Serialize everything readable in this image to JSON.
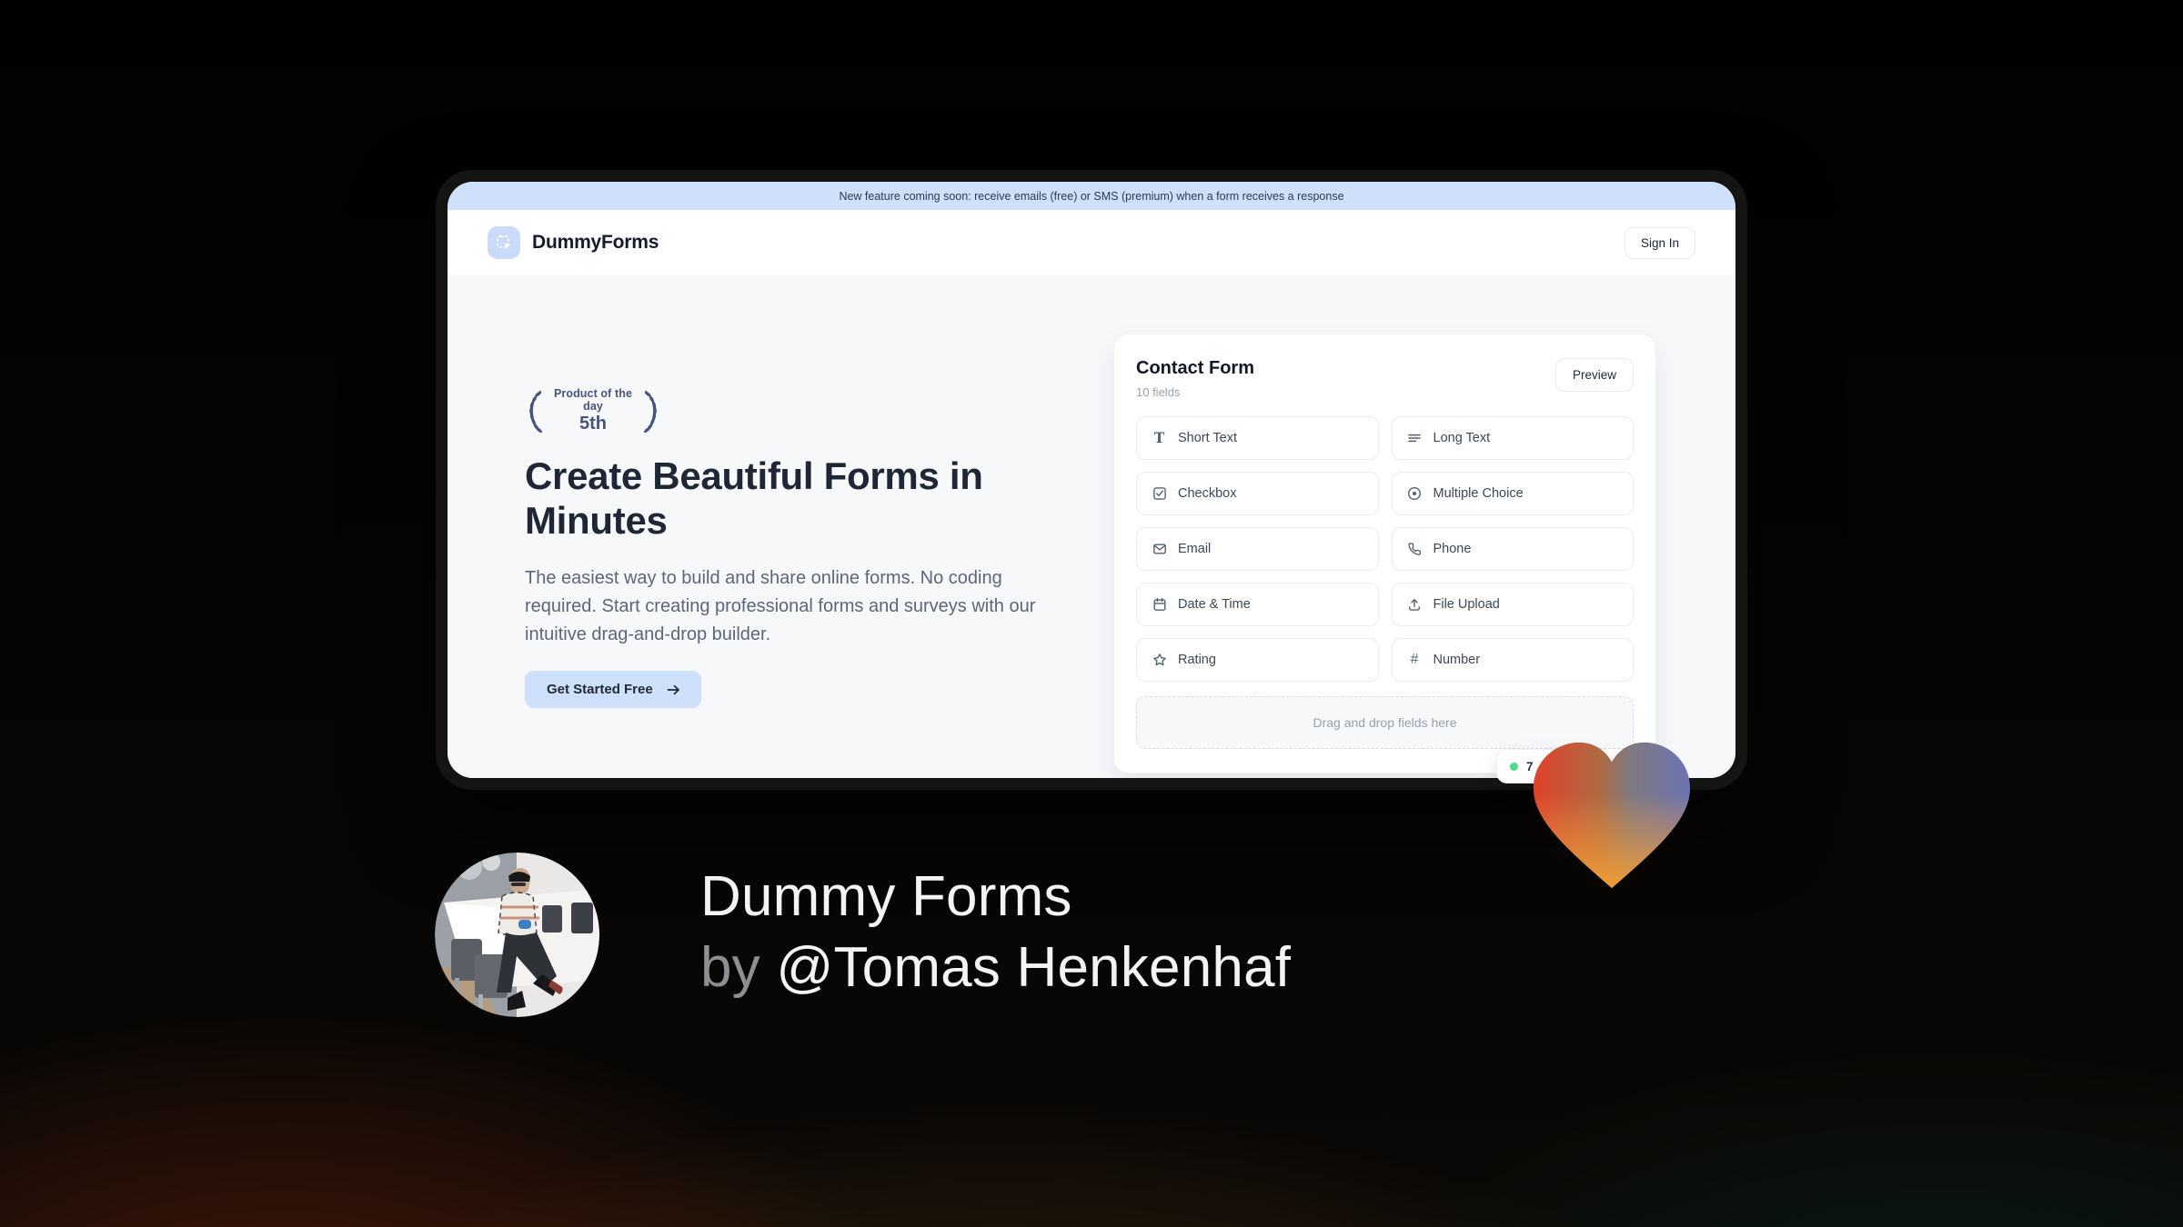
{
  "banner": {
    "text": "New feature coming soon: receive emails (free) or SMS (premium) when a form receives a response"
  },
  "header": {
    "brand": "DummyForms",
    "sign_in_label": "Sign In"
  },
  "hero": {
    "award_badge": {
      "line1": "Product of the day",
      "line2": "5th"
    },
    "title": "Create Beautiful Forms in Minutes",
    "description": "The easiest way to build and share online forms. No coding required. Start creating professional forms and surveys with our intuitive drag-and-drop builder.",
    "cta_label": "Get Started Free"
  },
  "form_builder": {
    "title": "Contact Form",
    "subtitle": "10 fields",
    "preview_label": "Preview",
    "fields": [
      {
        "label": "Short Text",
        "icon": "short-text-icon"
      },
      {
        "label": "Long Text",
        "icon": "long-text-icon"
      },
      {
        "label": "Checkbox",
        "icon": "checkbox-icon"
      },
      {
        "label": "Multiple Choice",
        "icon": "multiple-choice-icon"
      },
      {
        "label": "Email",
        "icon": "email-icon"
      },
      {
        "label": "Phone",
        "icon": "phone-icon"
      },
      {
        "label": "Date & Time",
        "icon": "calendar-icon"
      },
      {
        "label": "File Upload",
        "icon": "upload-icon"
      },
      {
        "label": "Rating",
        "icon": "star-icon"
      },
      {
        "label": "Number",
        "icon": "hash-icon"
      }
    ],
    "dropzone_text": "Drag and drop fields here",
    "status_badge": {
      "visible_text": "7",
      "dot_color": "#4ade80"
    }
  },
  "caption": {
    "line1": "Dummy Forms",
    "line2_prefix": "by ",
    "line2_name": "@Tomas Henkenhaf"
  },
  "colors": {
    "accent_light_blue": "#cfe0fa",
    "window_bezel": "#141413",
    "page_bg_base": "#040403",
    "heart_gradient": [
      "#e0422b",
      "#f29a37",
      "#6c74b4"
    ],
    "status_green": "#4ade80"
  }
}
